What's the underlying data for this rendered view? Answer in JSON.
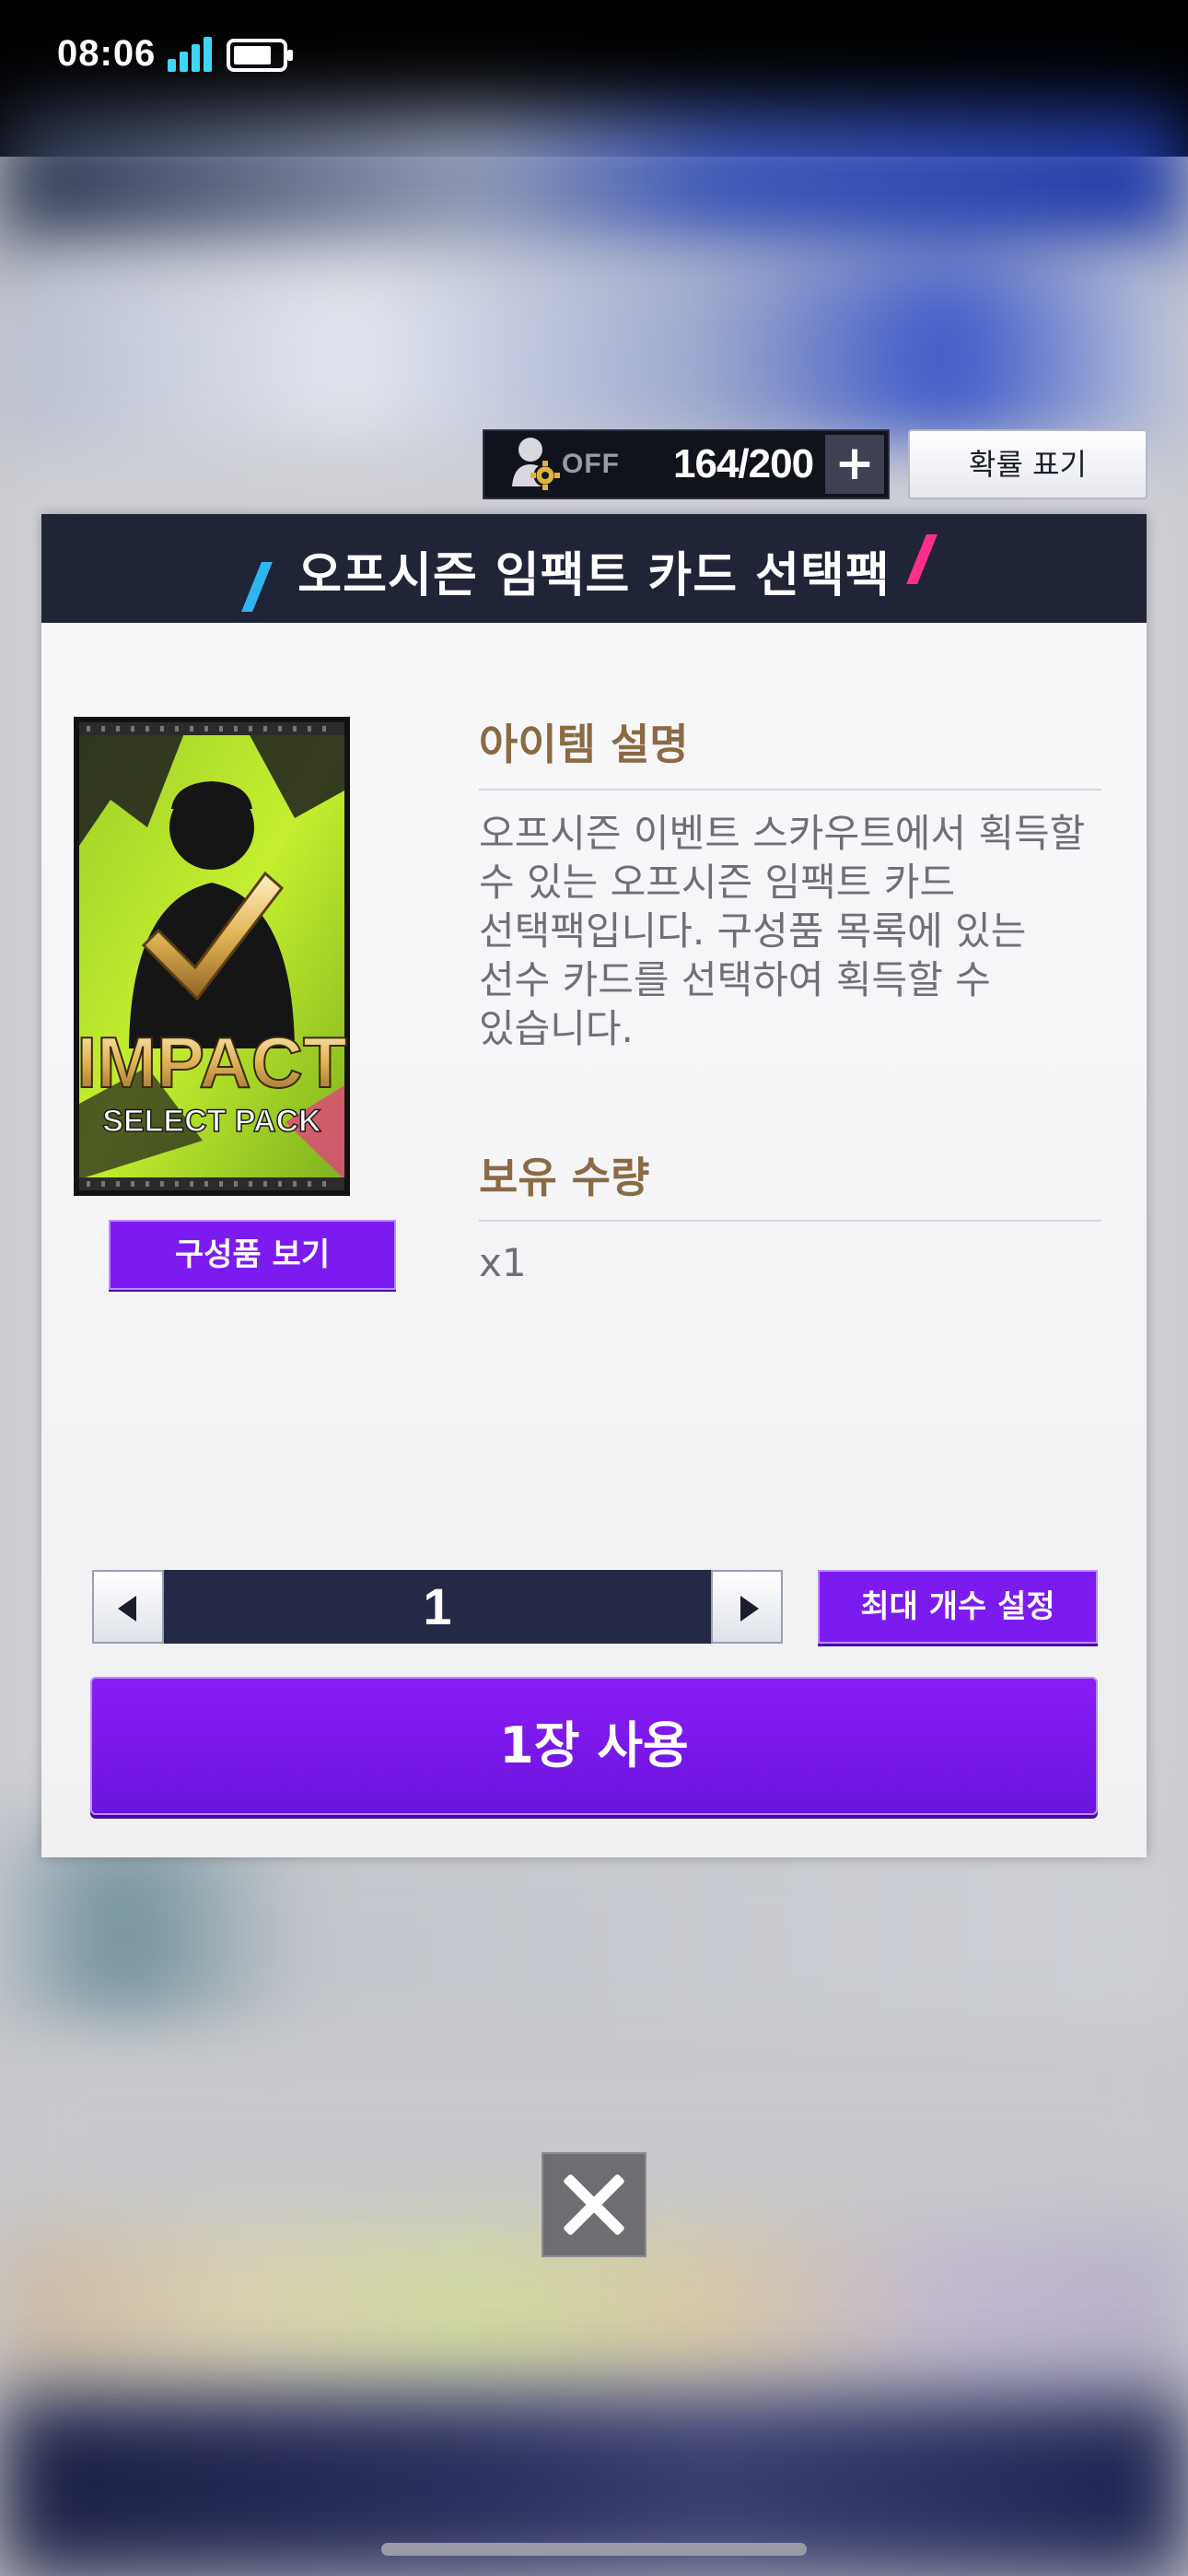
{
  "status_bar": {
    "time": "08:06",
    "signal_icon": "cellular-signal-icon",
    "battery_icon": "battery-icon"
  },
  "top_controls": {
    "auto_sell_status": "OFF",
    "slots_text": "164/200",
    "plus_label": "+",
    "probability_label": "확률 표기"
  },
  "modal": {
    "title": "오프시즌 임팩트 카드 선택팩",
    "pack_image": {
      "line1": "IMPACT",
      "line2": "SELECT PACK"
    },
    "contents_button_label": "구성품 보기",
    "description_heading": "아이템 설명",
    "description_text": "오프시즌 이벤트 스카우트에서 획득할\n수 있는 오프시즌 임팩트 카드\n선택팩입니다. 구성품 목록에 있는\n선수 카드를 선택하여 획득할 수\n있습니다.",
    "owned_heading": "보유 수량",
    "owned_value": "x1",
    "stepper": {
      "value": "1"
    },
    "max_button_label": "최대 개수 설정",
    "use_button_label": "1장 사용"
  },
  "colors": {
    "header_bg": "#1f2436",
    "accent_purple": "#7c1bf0",
    "heading_brown": "#8a6a45",
    "slash_blue": "#2fb6f0",
    "slash_pink": "#ff2e8f"
  }
}
